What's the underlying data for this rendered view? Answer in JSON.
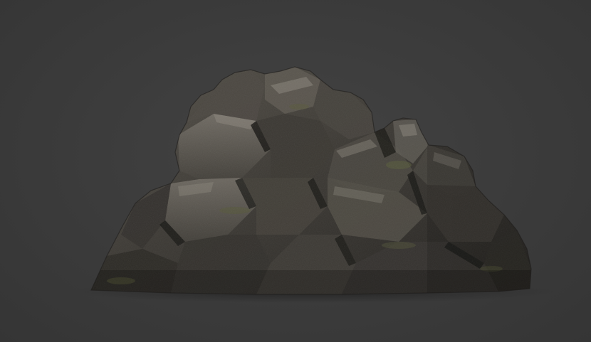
{
  "scene": {
    "subject": "rock-boulder",
    "colors": {
      "background": "#3a3a3a",
      "rock_shadow": "#1c1b19",
      "rock_dark": "#2a2825",
      "rock_mid": "#3f3c37",
      "rock_light": "#5e5a52",
      "rock_highlight": "#7d786e",
      "moss": "#55573a",
      "ground_shadow": "#262626"
    }
  }
}
